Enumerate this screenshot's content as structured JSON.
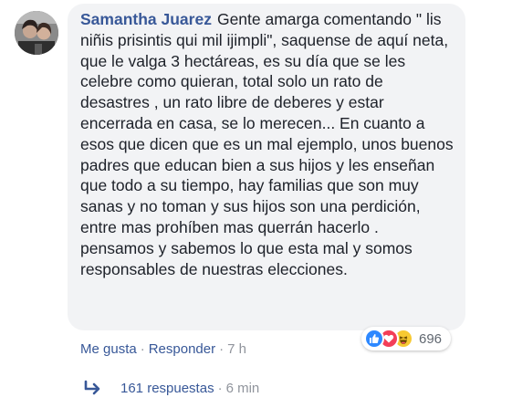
{
  "comment": {
    "author": "Samantha Juarez",
    "text": "Gente amarga comentando \" lis niñis prisintis qui mil ijimpli\", saquense de aquí neta, que le valga 3 hectáreas, es su día que se les celebre como quieran, total solo un rato de desastres , un rato libre de deberes y estar encerrada en casa, se lo merecen... En cuanto a esos que dicen que es un mal ejemplo, unos buenos padres que educan bien a sus hijos y les enseñan que todo a su tiempo, hay familias que son muy sanas y no toman y sus hijos son una perdición, entre mas prohíben mas querrán hacerlo . pensamos y sabemos lo que esta mal y somos responsables de nuestras elecciones."
  },
  "reactions": {
    "icons": [
      "like-icon",
      "love-icon",
      "haha-icon"
    ],
    "count": "696",
    "colors": {
      "like": "#2d88ff",
      "love": "#f33e58",
      "haha": "#f7c932"
    }
  },
  "actions": {
    "like_label": "Me gusta",
    "separator": "·",
    "reply_label": "Responder",
    "time": "7 h"
  },
  "replies": {
    "count_label": "161 respuestas",
    "separator": "·",
    "time": "6 min"
  },
  "colors": {
    "link": "#385898",
    "meta": "#90949c",
    "bubble": "#f2f3f5",
    "text": "#1d2129"
  }
}
